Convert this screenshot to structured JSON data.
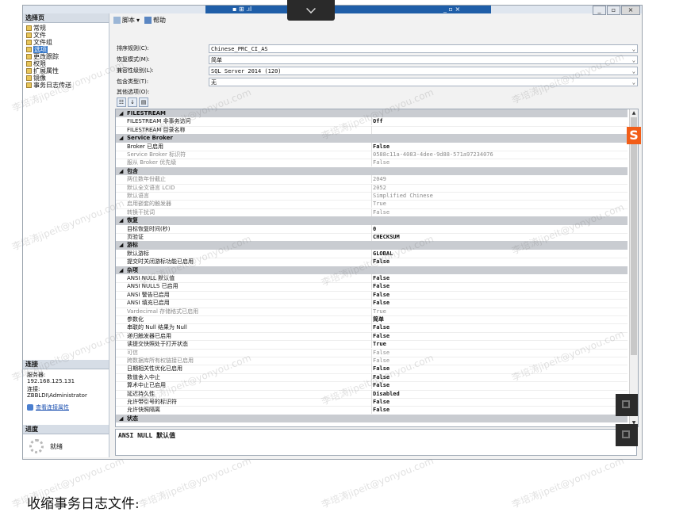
{
  "left": {
    "header": "选择页",
    "pages": [
      {
        "label": "常规",
        "selected": false
      },
      {
        "label": "文件",
        "selected": false
      },
      {
        "label": "文件组",
        "selected": false
      },
      {
        "label": "选项",
        "selected": true
      },
      {
        "label": "更改跟踪",
        "selected": false
      },
      {
        "label": "权限",
        "selected": false
      },
      {
        "label": "扩展属性",
        "selected": false
      },
      {
        "label": "镜像",
        "selected": false
      },
      {
        "label": "事务日志传送",
        "selected": false
      }
    ],
    "connection_header": "连接",
    "server_label": "服务器:",
    "server_value": "192.168.125.131",
    "conn_label": "连接:",
    "conn_value": "ZBBLDI\\Administrator",
    "view_link": "查看连接属性",
    "progress_header": "进度",
    "progress_status": "就绪"
  },
  "toolbar": {
    "script": "脚本",
    "help": "帮助"
  },
  "form": {
    "collation_label": "排序规则(C):",
    "collation_value": "Chinese_PRC_CI_AS",
    "recovery_label": "恢复模式(M):",
    "recovery_value": "简单",
    "compat_label": "兼容性级别(L):",
    "compat_value": "SQL Server 2014 (120)",
    "containment_label": "包含类型(T):",
    "containment_value": "无",
    "other_label": "其他选项(O):"
  },
  "grid": {
    "rows": [
      {
        "t": "cat",
        "n": "FILESTREAM"
      },
      {
        "t": "item",
        "n": "FILESTREAM 非事务访问",
        "v": "Off"
      },
      {
        "t": "item",
        "n": "FILESTREAM 目录名称",
        "v": ""
      },
      {
        "t": "cat",
        "n": "Service Broker"
      },
      {
        "t": "item",
        "n": "Broker 已启用",
        "v": "False"
      },
      {
        "t": "dim",
        "n": "Service Broker 标识符",
        "v": "0588c11a-4083-4dee-9d88-571a97234076"
      },
      {
        "t": "dim",
        "n": "服从 Broker 优先级",
        "v": "False"
      },
      {
        "t": "cat",
        "n": "包含"
      },
      {
        "t": "dim",
        "n": "两位数年份截止",
        "v": "2049"
      },
      {
        "t": "dim",
        "n": "默认全文语言 LCID",
        "v": "2052"
      },
      {
        "t": "dim",
        "n": "默认语言",
        "v": "Simplified Chinese"
      },
      {
        "t": "dim",
        "n": "启用嵌套的触发器",
        "v": "True"
      },
      {
        "t": "dim",
        "n": "转换干扰词",
        "v": "False"
      },
      {
        "t": "cat",
        "n": "恢复"
      },
      {
        "t": "item",
        "n": "目标恢复时间(秒)",
        "v": "0"
      },
      {
        "t": "item",
        "n": "页验证",
        "v": "CHECKSUM"
      },
      {
        "t": "cat",
        "n": "游标"
      },
      {
        "t": "item",
        "n": "默认游标",
        "v": "GLOBAL"
      },
      {
        "t": "item",
        "n": "提交时关闭游标功能已启用",
        "v": "False"
      },
      {
        "t": "cat",
        "n": "杂项"
      },
      {
        "t": "item",
        "n": "ANSI NULL 默认值",
        "v": "False"
      },
      {
        "t": "item",
        "n": "ANSI NULLS 已启用",
        "v": "False"
      },
      {
        "t": "item",
        "n": "ANSI 警告已启用",
        "v": "False"
      },
      {
        "t": "item",
        "n": "ANSI 填充已启用",
        "v": "False"
      },
      {
        "t": "dim",
        "n": "Vardecimal 存储格式已启用",
        "v": "True"
      },
      {
        "t": "item",
        "n": "参数化",
        "v": "简单"
      },
      {
        "t": "item",
        "n": "串联的 Null 结果为 Null",
        "v": "False"
      },
      {
        "t": "item",
        "n": "递归触发器已启用",
        "v": "False"
      },
      {
        "t": "item",
        "n": "读提交快照处于打开状态",
        "v": "True"
      },
      {
        "t": "dim",
        "n": "可信",
        "v": "False"
      },
      {
        "t": "dim",
        "n": "跨数据库所有权链接已启用",
        "v": "False"
      },
      {
        "t": "item",
        "n": "日期相关性优化已启用",
        "v": "False"
      },
      {
        "t": "item",
        "n": "数值舍入中止",
        "v": "False"
      },
      {
        "t": "item",
        "n": "算术中止已启用",
        "v": "False"
      },
      {
        "t": "item",
        "n": "延迟持久性",
        "v": "Disabled"
      },
      {
        "t": "item",
        "n": "允许带引号的标识符",
        "v": "False"
      },
      {
        "t": "item",
        "n": "允许快照隔离",
        "v": "False"
      },
      {
        "t": "cat",
        "n": "状态"
      }
    ]
  },
  "description": "ANSI NULL 默认值",
  "caption": "收缩事务日志文件:",
  "watermark": "李培涛jipeit@yonyou.com"
}
